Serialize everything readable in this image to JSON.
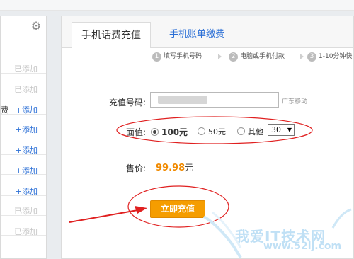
{
  "sidebar": {
    "gear": "gear-icon",
    "items": [
      {
        "label": "已添加",
        "state": "added"
      },
      {
        "label": "已添加",
        "state": "added"
      },
      {
        "label": "+添加",
        "prefix": "费",
        "state": "add"
      },
      {
        "label": "+添加",
        "state": "add"
      },
      {
        "label": "+添加",
        "state": "add"
      },
      {
        "label": "+添加",
        "state": "add"
      },
      {
        "label": "+添加",
        "state": "add"
      },
      {
        "label": "已添加",
        "state": "added"
      },
      {
        "label": "已添加",
        "state": "added"
      }
    ]
  },
  "tabs": {
    "active": "手机话费充值",
    "inactive": "手机账单缴费"
  },
  "steps": [
    {
      "num": "1",
      "label": "填写手机号码"
    },
    {
      "num": "2",
      "label": "电脑或手机付款"
    },
    {
      "num": "3",
      "label": "1-10分钟快"
    }
  ],
  "form": {
    "phone_label": "充值号码:",
    "carrier": "广东移动",
    "face_label": "面值:",
    "options": [
      {
        "label": "100元",
        "selected": true
      },
      {
        "label": "50元",
        "selected": false
      },
      {
        "label": "其他",
        "selected": false
      }
    ],
    "other_value": "30",
    "price_label": "售价:",
    "price_value": "99.98",
    "price_unit": "元",
    "submit": "立即充值"
  },
  "watermark": {
    "text": "我爱IT技术网",
    "url": "www.52ij.com"
  },
  "colors": {
    "accent": "#f59d00",
    "link": "#2b6fd6",
    "annotation": "#e02020"
  }
}
